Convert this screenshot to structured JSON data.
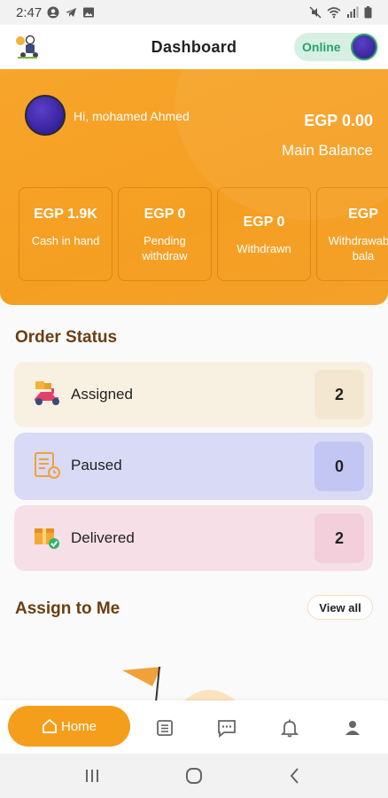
{
  "status_bar": {
    "time": "2:47"
  },
  "header": {
    "title": "Dashboard",
    "online_label": "Online"
  },
  "profile": {
    "greeting": "Hi, mohamed Ahmed",
    "balance_value": "EGP 0.00",
    "balance_label": "Main Balance"
  },
  "wallet_cards": [
    {
      "value": "EGP 1.9K",
      "label": "Cash in hand"
    },
    {
      "value": "EGP 0",
      "label": "Pending withdraw"
    },
    {
      "value": "EGP 0",
      "label": "Withdrawn"
    },
    {
      "value": "EGP",
      "label": "Withdrawable bala"
    }
  ],
  "order_status": {
    "title": "Order Status",
    "items": [
      {
        "label": "Assigned",
        "count": "2",
        "bg": "#f8f1e2",
        "count_bg": "#f3e7d1"
      },
      {
        "label": "Paused",
        "count": "0",
        "bg": "#d9daf6",
        "count_bg": "#c3c6f2"
      },
      {
        "label": "Delivered",
        "count": "2",
        "bg": "#f6dfe6",
        "count_bg": "#f2cfdb"
      }
    ]
  },
  "assign": {
    "title": "Assign to Me",
    "view_all": "View all"
  },
  "bottom_nav": {
    "home_label": "Home"
  },
  "colors": {
    "accent": "#f59e1c",
    "online_green": "#2aa36a",
    "section_title": "#6b3e12"
  }
}
